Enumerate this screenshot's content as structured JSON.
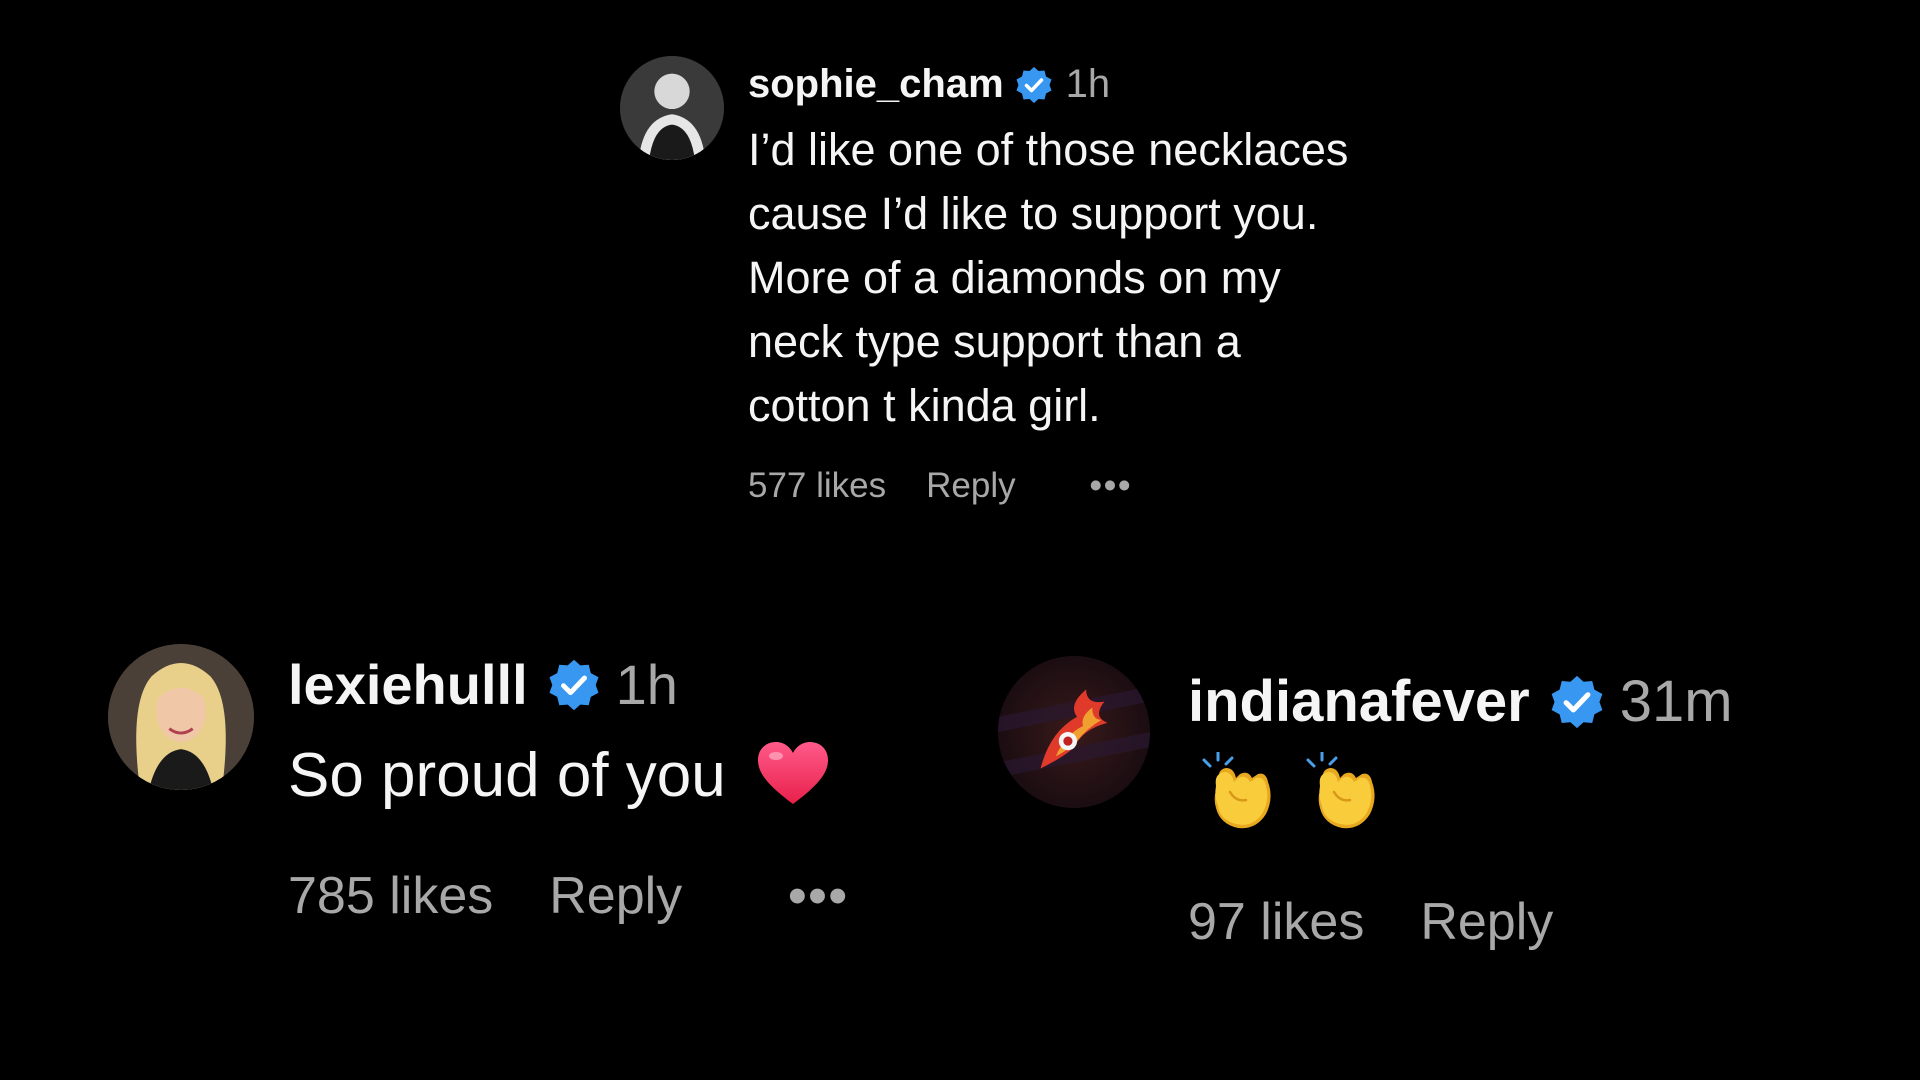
{
  "comments": [
    {
      "username": "sophie_cham",
      "time": "1h",
      "text_lines": [
        "I’d like one of those necklaces",
        "cause I’d like to support you.",
        "More of a diamonds on my",
        "neck type support than a",
        "cotton t kinda girl."
      ],
      "likes": "577 likes",
      "reply_label": "Reply",
      "more_label": "•••"
    },
    {
      "username": "lexiehulll",
      "time": "1h",
      "text": "So proud of you",
      "emoji": "heart-emoji",
      "likes": "785 likes",
      "reply_label": "Reply",
      "more_label": "•••"
    },
    {
      "username": "indianafever",
      "time": "31m",
      "emojis": [
        "clapping-hands-emoji",
        "clapping-hands-emoji"
      ],
      "likes": "97 likes",
      "reply_label": "Reply"
    }
  ],
  "colors": {
    "background": "#000000",
    "text": "#f5f5f5",
    "secondary_text": "#a8a8a8",
    "verified": "#3897f0",
    "heart": "#ff3b6b",
    "clap": "#f5c518"
  }
}
